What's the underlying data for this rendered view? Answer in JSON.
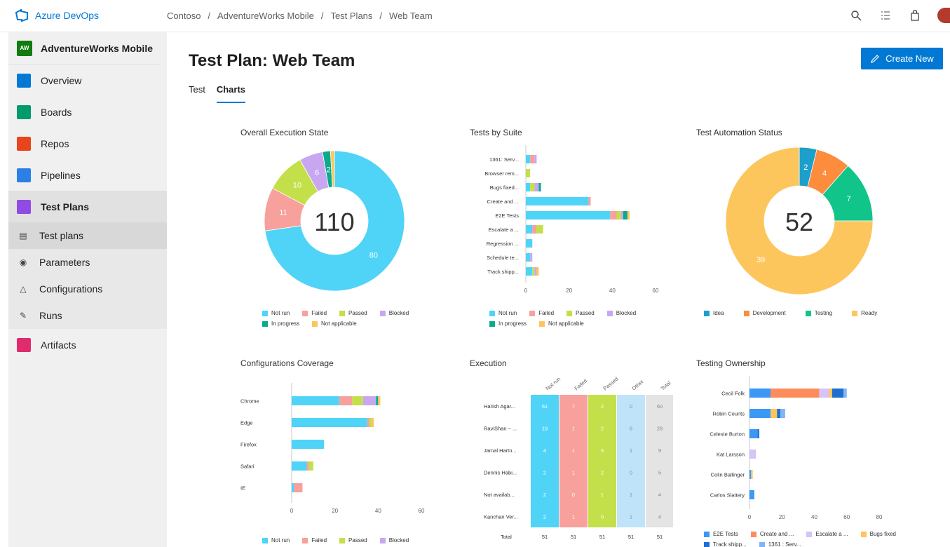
{
  "brand": {
    "name": "Azure DevOps"
  },
  "breadcrumb": [
    "Contoso",
    "AdventureWorks Mobile",
    "Test Plans",
    "Web Team"
  ],
  "colors": {
    "not_run": "#4fd4f7",
    "failed": "#f7a09c",
    "passed": "#c3e04a",
    "blocked": "#c9a7f0",
    "in_progress": "#0aab8c",
    "not_applicable": "#fcc65c",
    "idea": "#1c9fcb",
    "development": "#fd8c3d",
    "testing": "#10c48a",
    "ready": "#fdc65c",
    "brand": "#0078d4"
  },
  "sidebar": {
    "project_badge": "AW",
    "project": "AdventureWorks Mobile",
    "items": [
      {
        "label": "Overview",
        "icon": "overview-icon"
      },
      {
        "label": "Boards",
        "icon": "boards-icon"
      },
      {
        "label": "Repos",
        "icon": "repos-icon"
      },
      {
        "label": "Pipelines",
        "icon": "pipelines-icon"
      },
      {
        "label": "Test Plans",
        "icon": "test-plans-icon"
      }
    ],
    "sub_items": [
      {
        "label": "Test plans",
        "icon": "test-plans-list-icon"
      },
      {
        "label": "Parameters",
        "icon": "parameters-icon"
      },
      {
        "label": "Configurations",
        "icon": "configurations-icon"
      },
      {
        "label": "Runs",
        "icon": "runs-icon"
      }
    ],
    "artifacts": "Artifacts"
  },
  "page": {
    "title": "Test Plan: Web Team",
    "create_button": "Create New",
    "tabs": [
      "Test",
      "Charts"
    ]
  },
  "legend_labels": {
    "outcome": [
      "Not run",
      "Failed",
      "Passed",
      "Blocked",
      "In progress",
      "Not applicable"
    ],
    "automation": [
      "Idea",
      "Development",
      "Testing",
      "Ready"
    ]
  },
  "chart_data": [
    {
      "type": "pie",
      "title": "Overall Execution State",
      "center_label": "110",
      "slices": [
        {
          "name": "Not run",
          "value": 80
        },
        {
          "name": "Failed",
          "value": 11
        },
        {
          "name": "Passed",
          "value": 10
        },
        {
          "name": "Blocked",
          "value": 6
        },
        {
          "name": "In progress",
          "value": 2
        },
        {
          "name": "Not applicable",
          "value": 1
        }
      ]
    },
    {
      "type": "bar",
      "title": "Tests by Suite",
      "orientation": "horizontal",
      "stacked": true,
      "categories": [
        "1361: Serv...",
        "Browser rem...",
        "Bugs fixed...",
        "Create and ...",
        "E2E Tests",
        "Escalate a ...",
        "Regression ...",
        "Schedule te...",
        "Track shipp..."
      ],
      "series": [
        {
          "name": "Not run",
          "values": [
            2,
            0,
            2,
            29,
            39,
            3,
            3,
            2,
            3
          ]
        },
        {
          "name": "Failed",
          "values": [
            2,
            0,
            0,
            1,
            3,
            2,
            0,
            0,
            0
          ]
        },
        {
          "name": "Passed",
          "values": [
            0,
            2,
            2,
            0,
            2,
            3,
            0,
            0,
            1
          ]
        },
        {
          "name": "Blocked",
          "values": [
            1,
            0,
            2,
            0,
            1,
            0,
            0,
            1,
            1
          ]
        },
        {
          "name": "In progress",
          "values": [
            0,
            0,
            1,
            0,
            2,
            0,
            0,
            0,
            0
          ]
        },
        {
          "name": "Not applicable",
          "values": [
            0,
            0,
            0,
            0,
            1,
            0,
            0,
            0,
            1
          ]
        }
      ],
      "xticks": [
        0,
        20,
        40,
        60
      ],
      "xlim": [
        0,
        60
      ]
    },
    {
      "type": "pie",
      "title": "Test Automation Status",
      "center_label": "52",
      "slices": [
        {
          "name": "Idea",
          "value": 2
        },
        {
          "name": "Development",
          "value": 4
        },
        {
          "name": "Testing",
          "value": 7
        },
        {
          "name": "Ready",
          "value": 39
        }
      ]
    },
    {
      "type": "bar",
      "title": "Configurations Coverage",
      "orientation": "horizontal",
      "stacked": true,
      "categories": [
        "Chrome",
        "Edge",
        "Firefox",
        "Safari",
        "IE"
      ],
      "series": [
        {
          "name": "Not run",
          "values": [
            22,
            35,
            15,
            7,
            1
          ]
        },
        {
          "name": "Failed",
          "values": [
            6,
            1,
            0,
            1,
            4
          ]
        },
        {
          "name": "Passed",
          "values": [
            5,
            1,
            0,
            2,
            0
          ]
        },
        {
          "name": "Blocked",
          "values": [
            6,
            0,
            0,
            0,
            0
          ]
        },
        {
          "name": "In progress",
          "values": [
            1,
            0,
            0,
            0,
            0
          ]
        },
        {
          "name": "Not applicable",
          "values": [
            1,
            1,
            0,
            0,
            0
          ]
        }
      ],
      "xticks": [
        0,
        20,
        40,
        60
      ],
      "xlim": [
        0,
        60
      ]
    },
    {
      "type": "table",
      "title": "Execution",
      "columns": [
        "Not run",
        "Failed",
        "Passed",
        "Other",
        "Total"
      ],
      "rows": [
        {
          "name": "Harish Agar...",
          "values": [
            51,
            7,
            2,
            0,
            60
          ]
        },
        {
          "name": "RaviShan – ...",
          "values": [
            19,
            1,
            2,
            6,
            28
          ]
        },
        {
          "name": "Jamal Hartn...",
          "values": [
            4,
            1,
            3,
            1,
            9
          ]
        },
        {
          "name": "Dennis Habi...",
          "values": [
            2,
            1,
            2,
            0,
            5
          ]
        },
        {
          "name": "Not availab...",
          "values": [
            2,
            0,
            1,
            1,
            4
          ]
        },
        {
          "name": "Kanchan Ver...",
          "values": [
            2,
            1,
            0,
            1,
            4
          ]
        }
      ],
      "total_label": "Total",
      "totals": [
        "51",
        "51",
        "51",
        "51",
        "51"
      ]
    },
    {
      "type": "bar",
      "title": "Testing Ownership",
      "orientation": "horizontal",
      "stacked": true,
      "categories": [
        "Cecil Folk",
        "Robin Counts",
        "Celeste Burton",
        "Kat Larsson",
        "Colin Ballinger",
        "Carlos Slattery"
      ],
      "series": [
        {
          "name": "E2E Tests",
          "values": [
            13,
            13,
            5,
            0,
            1,
            3
          ]
        },
        {
          "name": "Create and ...",
          "values": [
            30,
            0,
            0,
            0,
            0,
            0
          ]
        },
        {
          "name": "Escalate a ...",
          "values": [
            6,
            0,
            0,
            4,
            0,
            0
          ]
        },
        {
          "name": "Bugs fixed...",
          "values": [
            2,
            4,
            0,
            0,
            1,
            0
          ]
        },
        {
          "name": "Track shipp...",
          "values": [
            7,
            2,
            1,
            0,
            0,
            0
          ]
        },
        {
          "name": "1361: Serv...",
          "values": [
            2,
            3,
            0,
            0,
            0,
            0
          ]
        }
      ],
      "series_colors": [
        "#3b98f5",
        "#fd8c5d",
        "#d5c4f5",
        "#fdc65c",
        "#1f6fd0",
        "#7fb5f8"
      ],
      "xticks": [
        0,
        20,
        40,
        60,
        80
      ],
      "xlim": [
        0,
        80
      ],
      "legend_visible": [
        "E2E Tests",
        "Create and ...",
        "Escalate a ...",
        "Bugs fixed",
        "Track shipp...",
        "1361 : Serv..."
      ]
    }
  ]
}
